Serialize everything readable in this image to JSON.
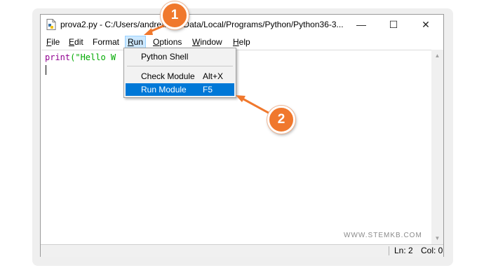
{
  "window": {
    "title": "prova2.py - C:/Users/andrea/AppData/Local/Programs/Python/Python36-3...",
    "minimize_glyph": "—",
    "maximize_glyph": "☐",
    "close_glyph": "✕"
  },
  "menubar": {
    "items": [
      {
        "label": "File",
        "underline": "F",
        "rest": "ile"
      },
      {
        "label": "Edit",
        "underline": "E",
        "rest": "dit"
      },
      {
        "label": "Format",
        "underline": "",
        "rest": "Format"
      },
      {
        "label": "Run",
        "underline": "R",
        "rest": "un"
      },
      {
        "label": "Options",
        "underline": "O",
        "rest": "ptions"
      },
      {
        "label": "Window",
        "underline": "W",
        "rest": "indow"
      },
      {
        "label": "Help",
        "underline": "H",
        "rest": "elp"
      }
    ],
    "active": "Run"
  },
  "editor": {
    "code_keyword": "print",
    "code_rest": "(\"Hello W"
  },
  "run_menu": {
    "python_shell": "Python Shell",
    "check_module": "Check Module",
    "check_module_shortcut": "Alt+X",
    "run_module": "Run Module",
    "run_module_shortcut": "F5",
    "highlighted": "Run Module"
  },
  "statusbar": {
    "line": "Ln: 2",
    "column": "Col: 0"
  },
  "watermark": "WWW.STEMKB.COM",
  "callouts": {
    "step1": "1",
    "step2": "2"
  },
  "colors": {
    "callout": "#f0782d",
    "highlight": "#0078d7",
    "active_menu": "#cce8ff"
  },
  "icons": {
    "app": "python-file-icon",
    "minimize": "minimize-icon",
    "maximize": "maximize-icon",
    "close": "close-icon"
  }
}
